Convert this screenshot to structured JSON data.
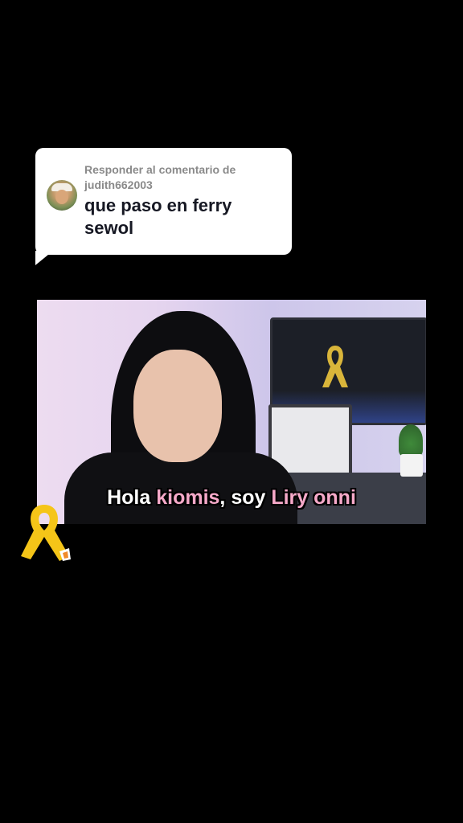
{
  "reply_card": {
    "meta_line1": "Responder al comentario de",
    "meta_line2": "judith662003",
    "comment_line1": "que paso en ferry",
    "comment_line2": "sewol"
  },
  "video": {
    "subtitle_part1": "Hola ",
    "subtitle_part2": "kiomis",
    "subtitle_part3": ", soy ",
    "subtitle_part4": "Liry onni"
  },
  "colors": {
    "background": "#000000",
    "bubble": "#ffffff",
    "subtitle_highlight": "#f6a9c9",
    "ribbon_yellow": "#f5c518"
  },
  "icons": {
    "ribbon": "yellow-ribbon-icon",
    "avatar": "commenter-avatar"
  }
}
